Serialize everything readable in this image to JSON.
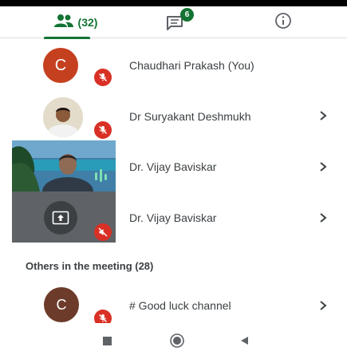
{
  "tabs": {
    "people_count": "(32)",
    "chat_badge": "6"
  },
  "participants": [
    {
      "name": "Chaudhari Prakash (You)",
      "avatar_letter": "C",
      "avatar_color": "#c5401f",
      "muted": true
    },
    {
      "name": "Dr Suryakant Deshmukh",
      "muted": true
    },
    {
      "name": "Dr. Vijay Baviskar",
      "video": true
    },
    {
      "name": "Dr. Vijay Baviskar",
      "screen_share": true,
      "muted": true
    }
  ],
  "others_header": "Others in the meeting (28)",
  "others": [
    {
      "name": "# Good luck channel",
      "avatar_letter": "C",
      "avatar_color": "#6d3b2a",
      "muted": true
    }
  ],
  "colors": {
    "accent": "#137333",
    "mute": "#d93025",
    "tile_gray": "#5f6368"
  },
  "icons": [
    "people-icon",
    "chat-icon",
    "info-icon",
    "mic-off-icon",
    "volume-off-icon",
    "present-screen-icon",
    "chevron-right-icon",
    "nav-square-icon",
    "nav-circle-icon",
    "nav-back-icon"
  ]
}
